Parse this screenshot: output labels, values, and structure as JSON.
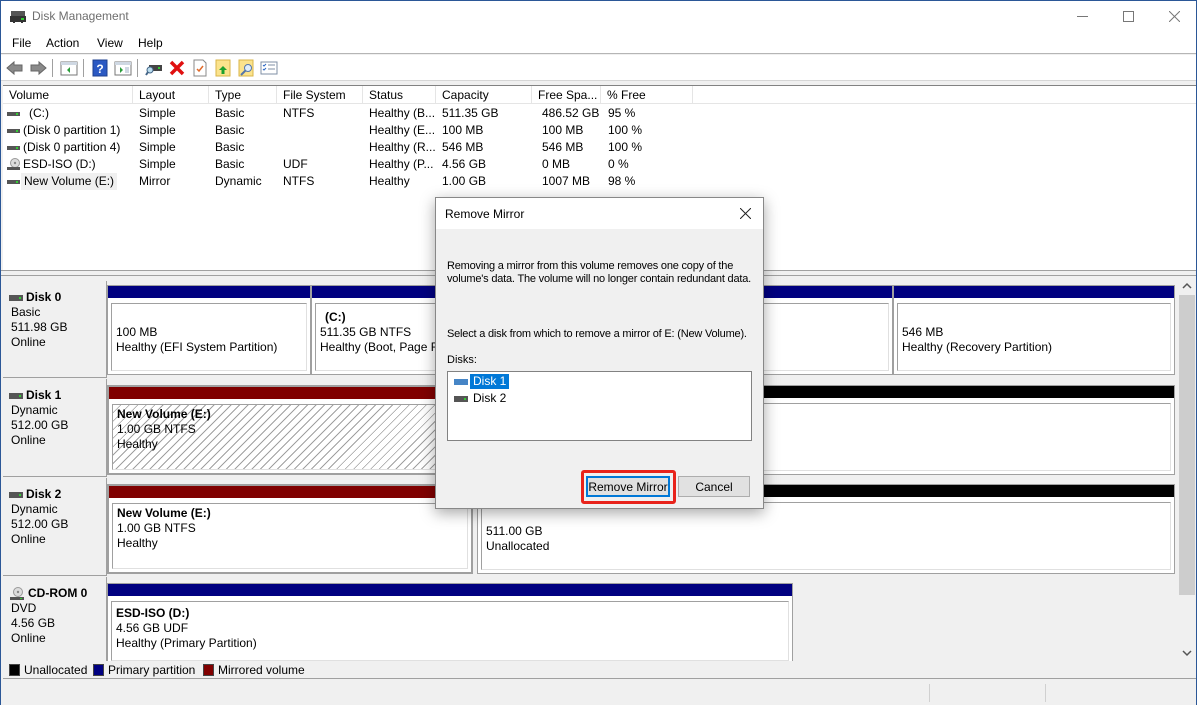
{
  "window": {
    "title": "Disk Management",
    "controls": {
      "minimize": "minimize-icon",
      "maximize": "maximize-icon",
      "close": "close-icon"
    }
  },
  "menu": [
    "File",
    "Action",
    "View",
    "Help"
  ],
  "toolbar": {
    "icons": [
      "back-icon",
      "forward-icon",
      "show-hide-console-tree-icon",
      "help-icon",
      "show-hide-action-pane-icon",
      "connect-disk-icon",
      "delete-icon",
      "properties-icon",
      "open-folder-icon",
      "explore-icon",
      "settings-list-icon"
    ]
  },
  "volume_list": {
    "columns": [
      "Volume",
      "Layout",
      "Type",
      "File System",
      "Status",
      "Capacity",
      "Free Spa...",
      "% Free"
    ],
    "rows": [
      {
        "volume": "(C:)",
        "icon": "disk-icon",
        "layout": "Simple",
        "type": "Basic",
        "fs": "NTFS",
        "status": "Healthy (B...",
        "capacity": "511.35 GB",
        "free": "486.52 GB",
        "pct": "95 %"
      },
      {
        "volume": "(Disk 0 partition 1)",
        "icon": "disk-icon",
        "layout": "Simple",
        "type": "Basic",
        "fs": "",
        "status": "Healthy (E...",
        "capacity": "100 MB",
        "free": "100 MB",
        "pct": "100 %"
      },
      {
        "volume": "(Disk 0 partition 4)",
        "icon": "disk-icon",
        "layout": "Simple",
        "type": "Basic",
        "fs": "",
        "status": "Healthy (R...",
        "capacity": "546 MB",
        "free": "546 MB",
        "pct": "100 %"
      },
      {
        "volume": "ESD-ISO (D:)",
        "icon": "cdrom-icon",
        "layout": "Simple",
        "type": "Basic",
        "fs": "UDF",
        "status": "Healthy (P...",
        "capacity": "4.56 GB",
        "free": "0 MB",
        "pct": "0 %"
      },
      {
        "volume": "New Volume (E:)",
        "icon": "disk-icon",
        "layout": "Mirror",
        "type": "Dynamic",
        "fs": "NTFS",
        "status": "Healthy",
        "capacity": "1.00 GB",
        "free": "1007 MB",
        "pct": "98 %"
      }
    ]
  },
  "disks": [
    {
      "name": "Disk 0",
      "type": "Basic",
      "size": "511.98 GB",
      "state": "Online",
      "partitions": [
        {
          "title": "",
          "line1": "100 MB",
          "line2": "Healthy (EFI System Partition)"
        },
        {
          "title": "(C:)",
          "line1": "511.35 GB NTFS",
          "line2": "Healthy (Boot, Page File, Crash Dump, Primary Partition)"
        },
        {
          "title": "",
          "line1": "546 MB",
          "line2": "Healthy (Recovery Partition)"
        }
      ]
    },
    {
      "name": "Disk 1",
      "type": "Dynamic",
      "size": "512.00 GB",
      "state": "Online",
      "partitions": [
        {
          "title": "New Volume  (E:)",
          "line1": "1.00 GB NTFS",
          "line2": "Healthy"
        },
        {
          "title": "",
          "line1": "",
          "line2": ""
        }
      ]
    },
    {
      "name": "Disk 2",
      "type": "Dynamic",
      "size": "512.00 GB",
      "state": "Online",
      "partitions": [
        {
          "title": "New Volume  (E:)",
          "line1": "1.00 GB NTFS",
          "line2": "Healthy"
        },
        {
          "title": "",
          "line1": "511.00 GB",
          "line2": "Unallocated"
        }
      ]
    },
    {
      "name": "CD-ROM 0",
      "type": "DVD",
      "size": "4.56 GB",
      "state": "Online",
      "partitions": [
        {
          "title": "ESD-ISO  (D:)",
          "line1": "4.56 GB UDF",
          "line2": "Healthy (Primary Partition)"
        }
      ]
    }
  ],
  "legend": [
    {
      "label": "Unallocated",
      "color": "#000000"
    },
    {
      "label": "Primary partition",
      "color": "#000080"
    },
    {
      "label": "Mirrored volume",
      "color": "#800000"
    }
  ],
  "colors": {
    "primary": "#000080",
    "mirror": "#800000",
    "unallocated": "#000000",
    "selection": "#0078d7",
    "highlight": "#e8231b"
  },
  "dialog": {
    "title": "Remove Mirror",
    "description": "Removing a mirror from this volume removes one copy of the volume's data. The volume will no longer contain redundant data.",
    "prompt": "Select a disk from which to remove a mirror of E: (New Volume).",
    "disks_label": "Disks:",
    "disks": [
      {
        "label": "Disk 1",
        "selected": true
      },
      {
        "label": "Disk 2",
        "selected": false
      }
    ],
    "ok_label": "Remove Mirror",
    "cancel_label": "Cancel"
  }
}
